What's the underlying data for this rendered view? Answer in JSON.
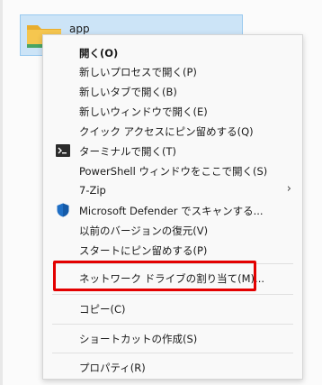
{
  "selected_file": {
    "name": "app",
    "icon": "folder-icon"
  },
  "menu": {
    "items": [
      {
        "label": "開く(O)",
        "bold": true
      },
      {
        "label": "新しいプロセスで開く(P)"
      },
      {
        "label": "新しいタブで開く(B)"
      },
      {
        "label": "新しいウィンドウで開く(E)"
      },
      {
        "label": "クイック アクセスにピン留めする(Q)"
      },
      {
        "label": "ターミナルで開く(T)",
        "icon": "terminal-icon"
      },
      {
        "label": "PowerShell ウィンドウをここで開く(S)"
      },
      {
        "label": "7-Zip",
        "submenu": true
      },
      {
        "label": "Microsoft Defender でスキャンする...",
        "icon": "shield-icon"
      },
      {
        "label": "以前のバージョンの復元(V)"
      },
      {
        "label": "スタートにピン留めする(P)"
      },
      {
        "label": "ネットワーク ドライブの割り当て(M)...",
        "highlighted": true
      },
      {
        "label": "コピー(C)"
      },
      {
        "label": "ショートカットの作成(S)"
      },
      {
        "label": "プロパティ(R)"
      }
    ],
    "submenu_arrow": "›"
  },
  "colors": {
    "selection": "#cce4f7",
    "highlight_border": "#e30000",
    "folder": "#f5c64f",
    "shield": "#1f6fc5"
  }
}
